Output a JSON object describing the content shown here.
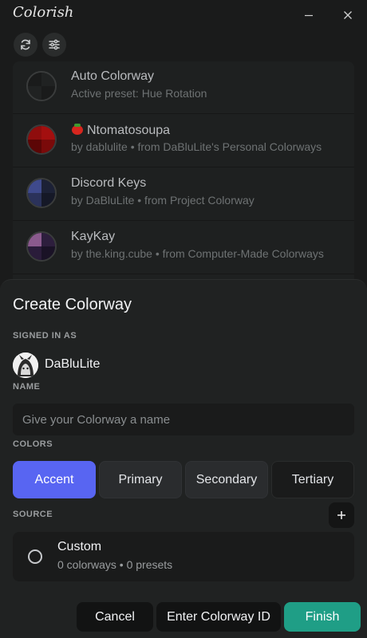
{
  "app": {
    "title": "Colorish"
  },
  "window": {
    "minimize_icon": "minimize-icon",
    "close_icon": "close-icon"
  },
  "toolbar": {
    "refresh_icon": "refresh-icon",
    "filter_icon": "filter-sliders-icon"
  },
  "colorways": [
    {
      "name": "Auto Colorway",
      "subtitle": "Active preset: Hue Rotation",
      "swatch": [
        "#1a1b1b",
        "#202222",
        "#202222",
        "#1a1b1b"
      ]
    },
    {
      "name": "Ntomatosoupa",
      "emoji": "tomato-icon",
      "subtitle": "by dablulite • from DaBluLite's Personal Colorways",
      "swatch": [
        "#8f0d0d",
        "#a30f0f",
        "#5c0606",
        "#7a0a0a"
      ]
    },
    {
      "name": "Discord Keys",
      "subtitle": "by DaBluLite • from Project Colorway",
      "swatch": [
        "#3f4a8c",
        "#1c2136",
        "#2b325a",
        "#151827"
      ]
    },
    {
      "name": "KayKay",
      "subtitle": "by the.king.cube • from Computer-Made Colorways",
      "swatch": [
        "#8a5a8d",
        "#2d1e3d",
        "#2a1c3a",
        "#1a1226"
      ]
    }
  ],
  "modal": {
    "title": "Create Colorway",
    "signed_in_label": "SIGNED IN AS",
    "user_name": "DaBluLite",
    "name_label": "NAME",
    "name_placeholder": "Give your Colorway a name",
    "colors_label": "COLORS",
    "color_tabs": [
      "Accent",
      "Primary",
      "Secondary",
      "Tertiary"
    ],
    "active_tab": "Accent",
    "source_label": "SOURCE",
    "source": {
      "name": "Custom",
      "subtitle": "0 colorways • 0 presets",
      "selected": false
    },
    "buttons": {
      "cancel": "Cancel",
      "enter_id": "Enter Colorway ID",
      "finish": "Finish"
    }
  },
  "colors": {
    "accent": "#5865f2",
    "finish": "#1f9e86"
  }
}
